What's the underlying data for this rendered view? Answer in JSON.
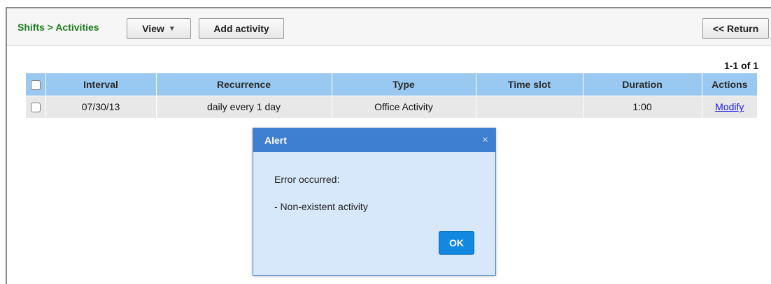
{
  "toolbar": {
    "breadcrumb": "Shifts > Activities",
    "view_label": "View",
    "add_activity_label": "Add activity",
    "return_label": "<< Return"
  },
  "pagination": {
    "count": "1-1 of 1"
  },
  "table": {
    "headers": {
      "interval": "Interval",
      "recurrence": "Recurrence",
      "type": "Type",
      "time_slot": "Time slot",
      "duration": "Duration",
      "actions": "Actions"
    },
    "rows": [
      {
        "interval": "07/30/13",
        "recurrence": "daily every 1 day",
        "type": "Office Activity",
        "time_slot": "",
        "duration": "1:00",
        "action": "Modify",
        "checked": false
      }
    ]
  },
  "dialog": {
    "title": "Alert",
    "close_icon": "×",
    "message_line1": "Error occurred:",
    "message_line2": "- Non-existent activity",
    "ok_label": "OK"
  },
  "colors": {
    "breadcrumb": "#1c7a1c",
    "header_bg": "#99c9f1",
    "row_bg": "#e8e8e8",
    "dialog_header": "#3e7fd1",
    "dialog_body": "#d6e8f9",
    "ok_button": "#1288e0",
    "link": "#1a1aee"
  }
}
